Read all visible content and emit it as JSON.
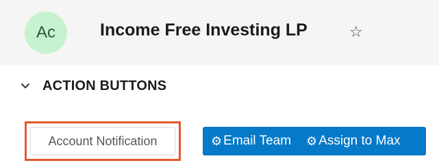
{
  "record": {
    "avatar_initials": "Ac",
    "name": "Income Free Investing LP",
    "favorite_icon": "star-outline-icon"
  },
  "section": {
    "title": "ACTION BUTTONS",
    "toggle_icon": "chevron-down-icon"
  },
  "buttons": {
    "account_notification": "Account Notification",
    "email_team": "Email Team",
    "assign_to_max": "Assign to Max",
    "gear_icon": "⚙"
  },
  "colors": {
    "avatar_bg": "#c7f2cf",
    "button_blue": "#0679c8",
    "highlight_border": "#e4572e"
  }
}
